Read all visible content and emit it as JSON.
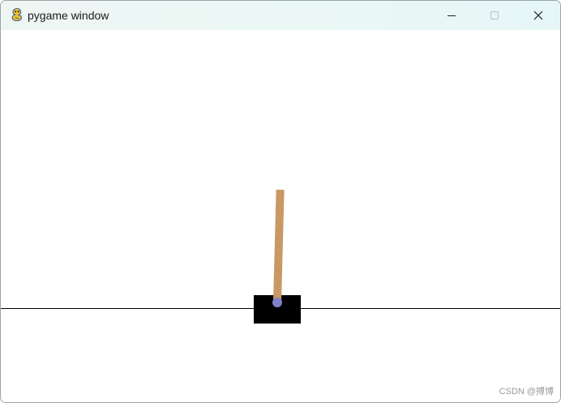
{
  "window": {
    "title": "pygame window",
    "icon": "pygame-snake-icon"
  },
  "controls": {
    "minimize_icon": "minimize-icon",
    "maximize_icon": "maximize-icon",
    "close_icon": "close-icon"
  },
  "scene": {
    "background": "#ffffff",
    "track_color": "#000000",
    "cart_color": "#000000",
    "pole_color": "#ca9865",
    "axle_color": "#8181ca",
    "pole_angle_deg": 1.5
  },
  "watermark": {
    "text": "CSDN @搏博"
  }
}
